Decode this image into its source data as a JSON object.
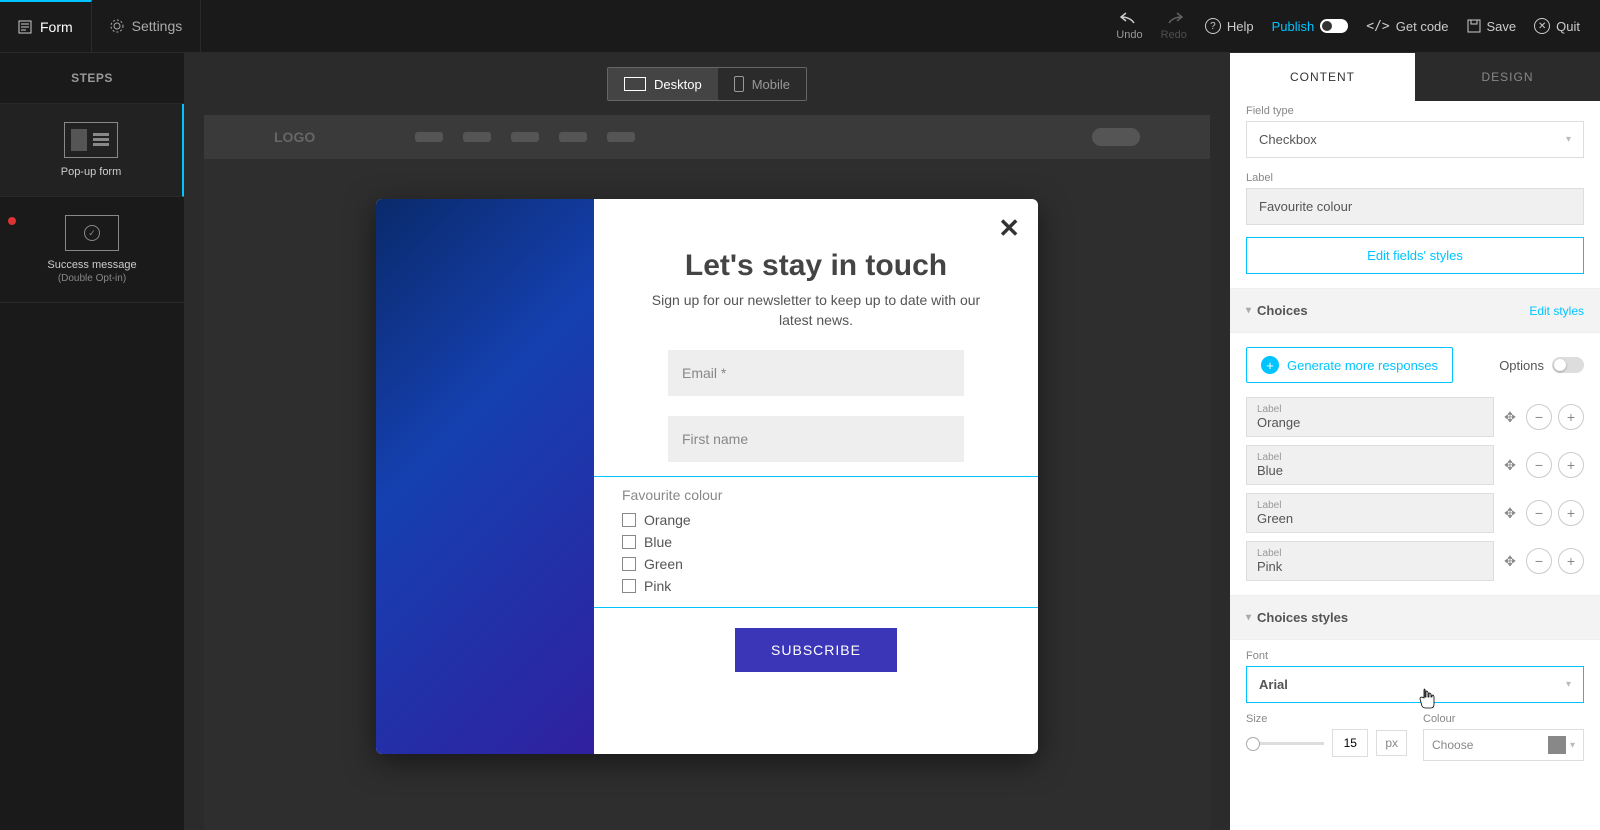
{
  "topbar": {
    "form_tab": "Form",
    "settings_tab": "Settings",
    "undo": "Undo",
    "redo": "Redo",
    "help": "Help",
    "publish": "Publish",
    "get_code": "Get code",
    "save": "Save",
    "quit": "Quit"
  },
  "sidebar": {
    "steps_header": "STEPS",
    "items": [
      {
        "label": "Pop-up form",
        "sub": ""
      },
      {
        "label": "Success message",
        "sub": "(Double Opt-in)"
      }
    ]
  },
  "device": {
    "desktop": "Desktop",
    "mobile": "Mobile"
  },
  "stage": {
    "logo": "LOGO"
  },
  "popup": {
    "title": "Let's stay in touch",
    "subtitle": "Sign up for our newsletter to keep up to date with our latest news.",
    "email_placeholder": "Email *",
    "firstname_placeholder": "First name",
    "fav_label": "Favourite colour",
    "options": [
      "Orange",
      "Blue",
      "Green",
      "Pink"
    ],
    "subscribe": "SUBSCRIBE"
  },
  "panel": {
    "tabs": {
      "content": "CONTENT",
      "design": "DESIGN"
    },
    "field_type_label": "Field type",
    "field_type_value": "Checkbox",
    "label_label": "Label",
    "label_value": "Favourite colour",
    "edit_fields_styles": "Edit fields' styles",
    "choices_title": "Choices",
    "edit_styles": "Edit styles",
    "generate": "Generate more responses",
    "options_label": "Options",
    "choice_label": "Label",
    "choices": [
      "Orange",
      "Blue",
      "Green",
      "Pink"
    ],
    "choices_styles_title": "Choices styles",
    "font_label": "Font",
    "font_value": "Arial",
    "size_label": "Size",
    "size_value": "15",
    "px": "px",
    "colour_label": "Colour",
    "colour_value": "Choose"
  }
}
